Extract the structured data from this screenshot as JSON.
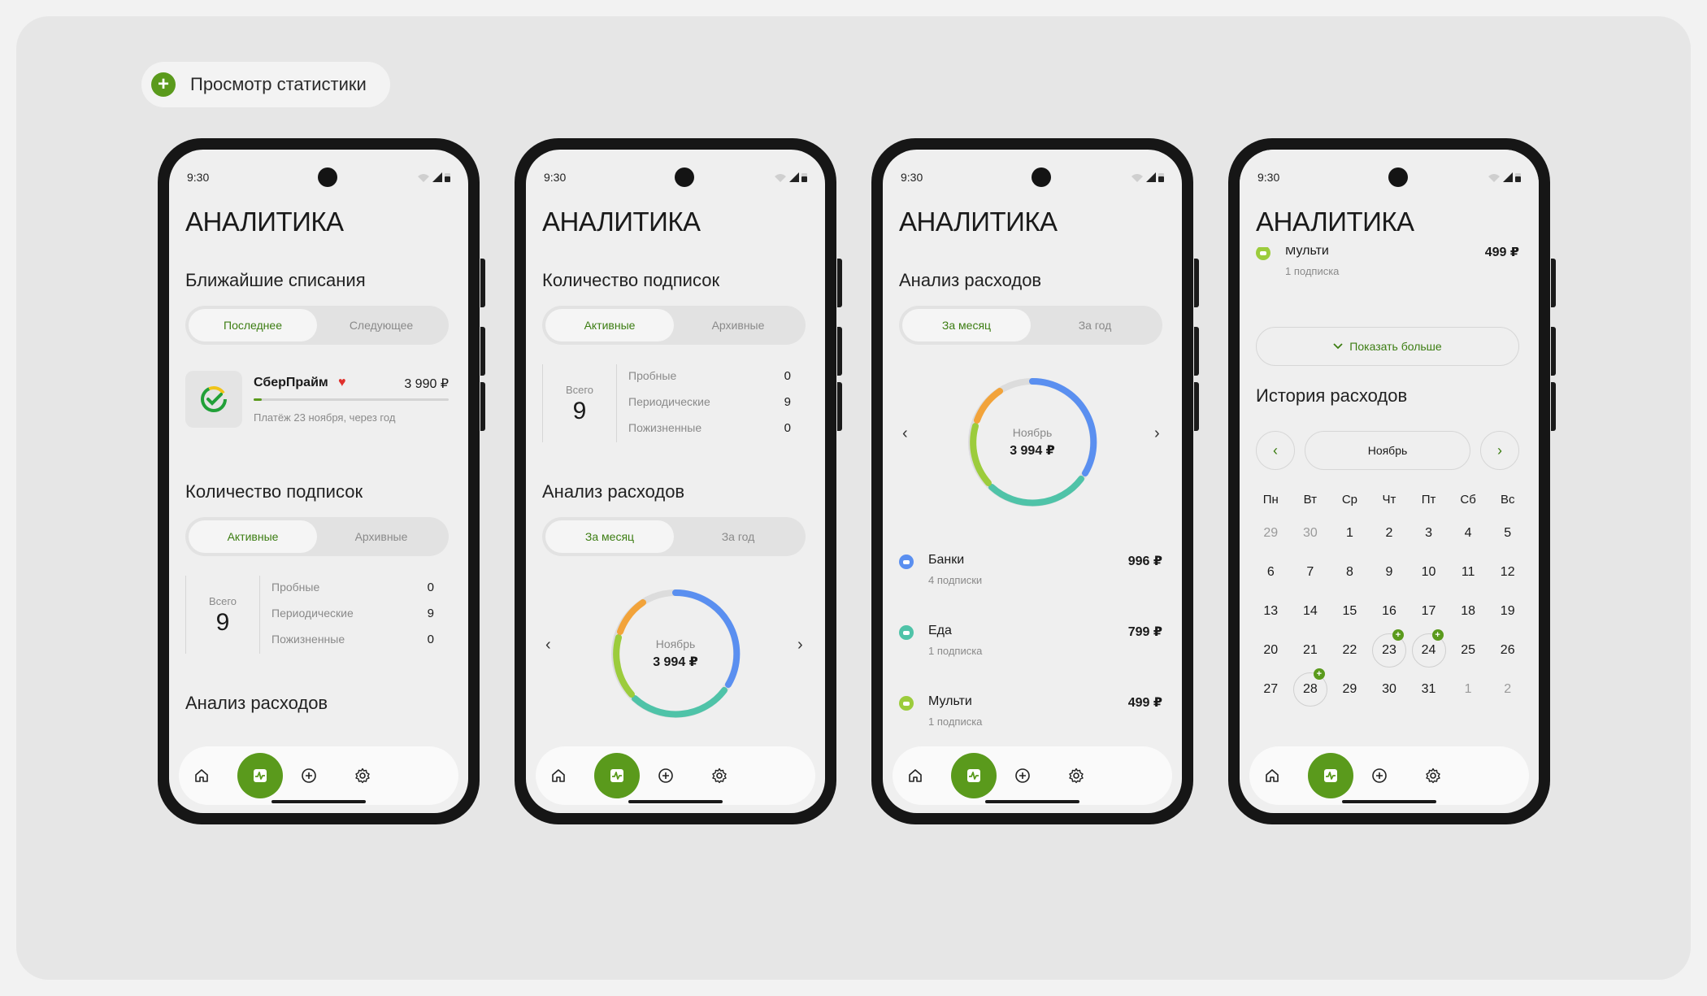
{
  "header": {
    "label": "Просмотр статистики"
  },
  "status": {
    "time": "9:30"
  },
  "app": {
    "title": "АНАЛИТИКА"
  },
  "colors": {
    "accent": "#5a9a1c",
    "accent_text": "#3c7d12",
    "heart": "#e0302c"
  },
  "phone1": {
    "upcoming_title": "Ближайшие списания",
    "upcoming_tabs": [
      "Последнее",
      "Следующее"
    ],
    "subscription": {
      "name": "СберПрайм",
      "price": "3 990 ₽",
      "date": "Платёж 23 ноября, через год",
      "progress": 0.04
    },
    "count_title": "Количество подписок",
    "count_tabs": [
      "Активные",
      "Архивные"
    ],
    "analysis_title": "Анализ расходов"
  },
  "stats": {
    "total_label": "Всего",
    "total": "9",
    "rows": [
      {
        "label": "Пробные",
        "value": "0"
      },
      {
        "label": "Периодические",
        "value": "9"
      },
      {
        "label": "Пожизненные",
        "value": "0"
      }
    ]
  },
  "phone2": {
    "count_title": "Количество подписок",
    "count_tabs": [
      "Активные",
      "Архивные"
    ],
    "analysis_title": "Анализ расходов",
    "period_tabs": [
      "За месяц",
      "За год"
    ]
  },
  "donut": {
    "month": "Ноябрь",
    "amount": "3 994 ₽",
    "prev": "‹",
    "next": "›"
  },
  "phone3": {
    "analysis_title": "Анализ расходов",
    "period_tabs": [
      "За месяц",
      "За год"
    ],
    "categories": [
      {
        "name": "Банки",
        "sub": "4 подписки",
        "price": "996 ₽",
        "color": "#5a8ff0"
      },
      {
        "name": "Еда",
        "sub": "1 подписка",
        "price": "799 ₽",
        "color": "#4fc3a8"
      },
      {
        "name": "Мульти",
        "sub": "1 подписка",
        "price": "499 ₽",
        "color": "#9ccc3c"
      }
    ]
  },
  "phone4": {
    "partial_item": {
      "name": "Мульти",
      "sub": "1 подписка",
      "price": "499 ₽"
    },
    "show_more": "Показать больше",
    "history_title": "История расходов",
    "month": "Ноябрь",
    "weekdays": [
      "Пн",
      "Вт",
      "Ср",
      "Чт",
      "Пт",
      "Сб",
      "Вс"
    ],
    "weeks": [
      [
        "29",
        "30",
        "1",
        "2",
        "3",
        "4",
        "5"
      ],
      [
        "6",
        "7",
        "8",
        "9",
        "10",
        "11",
        "12"
      ],
      [
        "13",
        "14",
        "15",
        "16",
        "17",
        "18",
        "19"
      ],
      [
        "20",
        "21",
        "22",
        "23",
        "24",
        "25",
        "26"
      ],
      [
        "27",
        "28",
        "29",
        "30",
        "31",
        "1",
        "2"
      ]
    ],
    "badge": "+"
  },
  "nav": [
    "home-icon",
    "analytics-icon",
    "add-icon",
    "settings-icon"
  ]
}
